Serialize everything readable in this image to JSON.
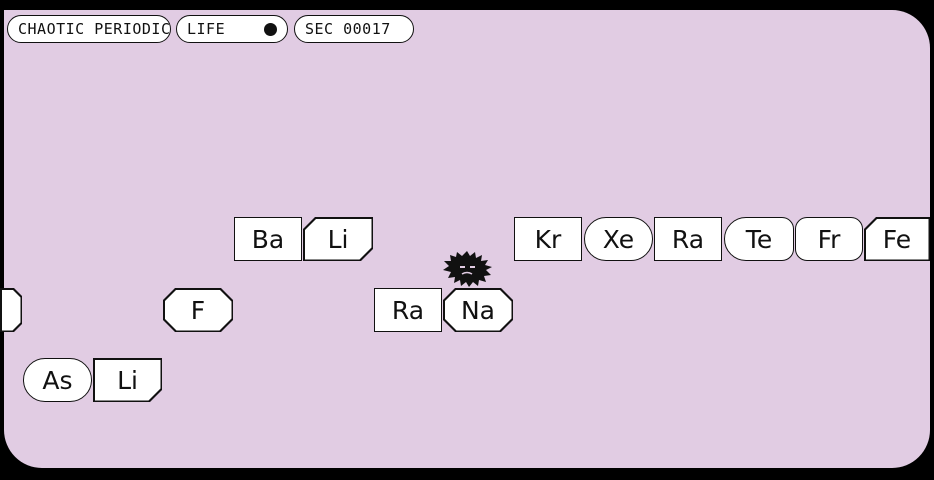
{
  "hud": {
    "title": "CHAOTIC PERIODIC",
    "life_label": "LIFE",
    "life_icon": "life-dot-icon",
    "sec_label": "SEC 00017"
  },
  "tiles": {
    "ba": "Ba",
    "li_top": "Li",
    "kr": "Kr",
    "xe": "Xe",
    "ra_top": "Ra",
    "te": "Te",
    "fr": "Fr",
    "fe": "Fe",
    "f": "F",
    "ra_mid": "Ra",
    "na": "Na",
    "as": "As",
    "li_bottom": "Li"
  },
  "player": {
    "icon": "spiky-blob-player-icon"
  },
  "colors": {
    "background": "#e1cce3",
    "frame": "#000000",
    "tile": "#ffffff",
    "ink": "#111111"
  }
}
